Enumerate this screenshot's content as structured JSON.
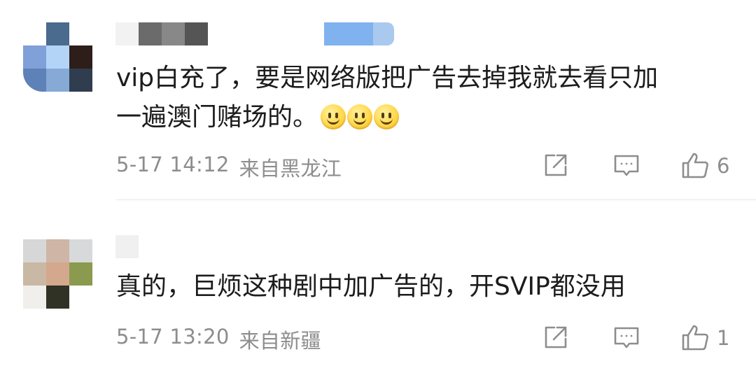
{
  "comments": [
    {
      "text": "vip白充了，要是网络版把广告去掉我就去看只加\n一遍澳门赌场的。",
      "emoji_count": 3,
      "timestamp": "5-17 14:12",
      "location": "来自黑龙江",
      "likes": "6",
      "avatar_colors": [
        "#ffffff",
        "#4a6a8e",
        "#ffffff",
        "#7fa0d8",
        "#b4d4f7",
        "#2d1e1a",
        "#5e82b8",
        "#86a9d6",
        "#2f3d4f"
      ],
      "username_colors": [
        "#f2f2f2",
        "#6b6b6b",
        "#888888",
        "#555555",
        "#ffffff",
        "#ffffff"
      ],
      "has_badge": true,
      "icons": [
        "share-icon",
        "comment-icon",
        "thumbs-up-icon"
      ]
    },
    {
      "text": "真的，巨烦这种剧中加广告的，开SVIP都没用",
      "emoji_count": 0,
      "timestamp": "5-17 13:20",
      "location": "来自新疆",
      "likes": "1",
      "avatar_colors": [
        "#d7d7d7",
        "#cfb5a6",
        "#d8d9db",
        "#c9b8a4",
        "#d3a88d",
        "#8a9b4f",
        "#f0efec",
        "#2f3225",
        "#ffffff"
      ],
      "username_colors": [
        "#f0f0f0"
      ],
      "has_badge": false,
      "icons": [
        "share-icon",
        "comment-icon",
        "thumbs-up-icon"
      ]
    }
  ],
  "colors": {
    "text": "#1c1c1c",
    "meta": "#8d8d8d",
    "divider": "#e6e6e6",
    "badge": "#7fb2ef"
  }
}
